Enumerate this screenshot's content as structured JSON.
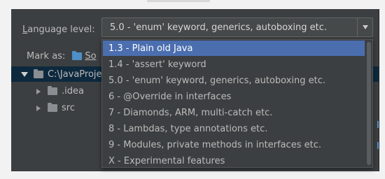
{
  "language_level": {
    "label_prefix": "",
    "label_mnemonic": "L",
    "label_rest": "anguage level:",
    "selected_value": "5.0 - 'enum' keyword, generics, autoboxing etc."
  },
  "mark_as": {
    "label": "Mark as:",
    "sources_button_label": "So"
  },
  "tree": {
    "root_label": "C:\\JavaProje",
    "children": [
      ".idea",
      "src"
    ]
  },
  "dropdown": {
    "options": [
      "1.3 - Plain old Java",
      "1.4 - 'assert' keyword",
      "5.0 - 'enum' keyword, generics, autoboxing etc.",
      "6 - @Override in interfaces",
      "7 - Diamonds, ARM, multi-catch etc.",
      "8 - Lambdas, type annotations etc.",
      "9 - Modules, private methods in interfaces etc.",
      "X - Experimental features"
    ],
    "highlighted_index": 0
  },
  "colors": {
    "panel_bg": "#3c3f41",
    "selection_blue": "#4b6eaf",
    "tree_selection": "#0d293e",
    "source_folder_blue": "#4e8fc8"
  }
}
